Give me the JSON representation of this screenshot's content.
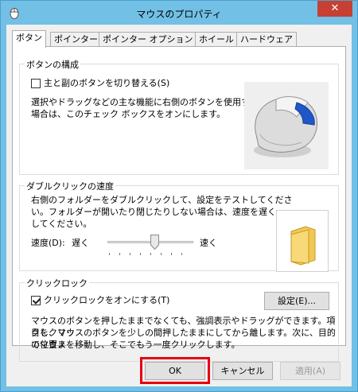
{
  "window": {
    "title": "マウスのプロパティ",
    "close_glyph": "✕"
  },
  "tabs": [
    {
      "label": "ボタン",
      "active": true
    },
    {
      "label": "ポインター",
      "active": false
    },
    {
      "label": "ポインター オプション",
      "active": false
    },
    {
      "label": "ホイール",
      "active": false
    },
    {
      "label": "ハードウェア",
      "active": false
    }
  ],
  "button_config": {
    "legend": "ボタンの構成",
    "swap_checkbox_label": "主と副のボタンを切り替える(S)",
    "swap_checked": false,
    "description_line1": "選択やドラッグなどの主な機能に右側のボタンを使用する",
    "description_line2": "場合は、このチェック ボックスをオンにします。"
  },
  "double_click": {
    "legend": "ダブルクリックの速度",
    "description_line1": "右側のフォルダーをダブルクリックして、設定をテストしてくださ",
    "description_line2": "い。フォルダーが開いたり閉じたりしない場合は、速度を遅く",
    "description_line3": "してください。",
    "speed_label": "速度(D):",
    "slow_label": "遅く",
    "fast_label": "速く",
    "speed_fraction": 0.55
  },
  "click_lock": {
    "legend": "クリックロック",
    "checkbox_label": "クリックロックをオンにする(T)",
    "checked": true,
    "settings_button": "設定(E)...",
    "description_line1": "マウスのボタンを押したままでなくても、強調表示やドラッグができます。項目をクリッ",
    "description_line2": "クし、マウスのボタンを少しの間押したままにしてから離します。次に、目的の位置ま",
    "description_line3": "でマウスを移動し、そこでもう一度クリックします。"
  },
  "footer": {
    "ok": "OK",
    "cancel": "キャンセル",
    "apply": "適用(A)"
  },
  "colors": {
    "frame": "#72c0e6",
    "close": "#c74034",
    "highlight": "#e60012"
  }
}
